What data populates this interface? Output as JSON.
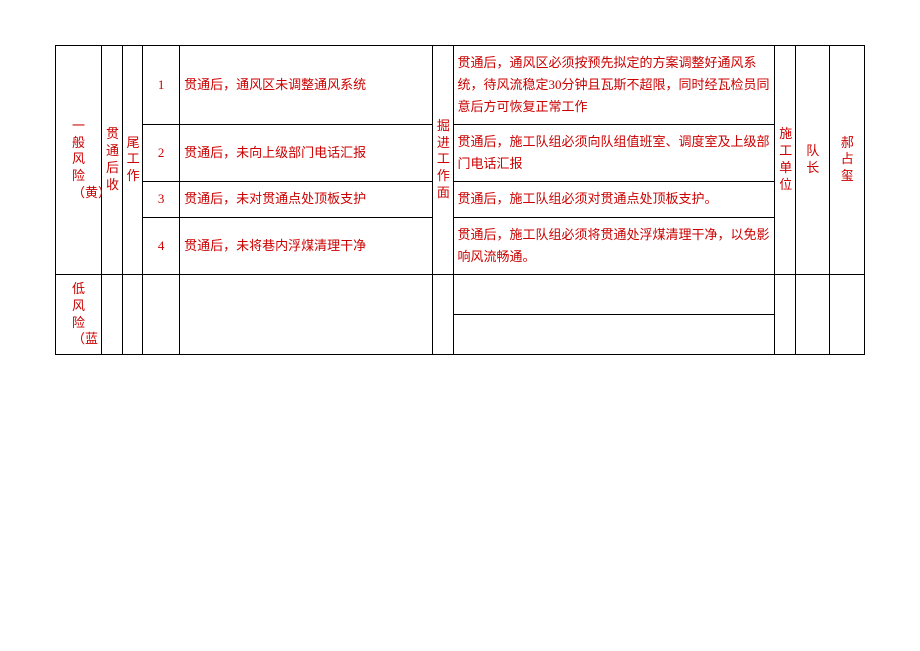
{
  "table": {
    "risk_level_1": "一般风险（黄）",
    "phase": "贯通后收尾工作",
    "rows": [
      {
        "num": "1",
        "risk": "贯通后，通风区未调整通风系统",
        "measure": "贯通后，通风区必须按预先拟定的方案调整好通风系统，待风流稳定30分钟且瓦斯不超限，同时经瓦检员同意后方可恢复正常工作"
      },
      {
        "num": "2",
        "risk": "贯通后，未向上级部门电话汇报",
        "measure": "贯通后，施工队组必须向队组值班室、调度室及上级部门电话汇报"
      },
      {
        "num": "3",
        "risk": "贯通后，未对贯通点处顶板支护",
        "measure": "贯通后，施工队组必须对贯通点处顶板支护。"
      },
      {
        "num": "4",
        "risk": "贯通后，未将巷内浮煤清理干净",
        "measure": "贯通后，施工队组必须将贯通处浮煤清理干净，以免影响风流畅通。"
      }
    ],
    "area": "掘进工作面",
    "unit": "施工单位",
    "role": "队长",
    "person": "郝占玺",
    "risk_level_2": "低风险（蓝"
  }
}
